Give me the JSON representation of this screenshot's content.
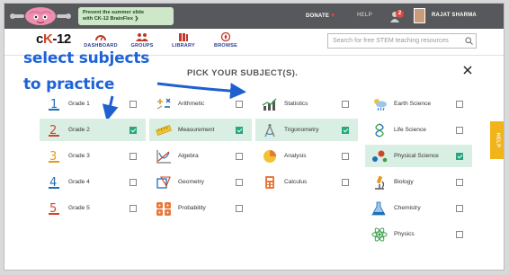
{
  "promo": {
    "line1": "Prevent the summer slide",
    "line2": "with CK-12 BrainFlex ❯"
  },
  "topbar": {
    "donate": "DONATE",
    "help": "HELP",
    "notif_count": "2",
    "user": "RAJAT SHARMA"
  },
  "logo": {
    "prefix": "c",
    "k": "K",
    "suffix": "-12"
  },
  "nav": [
    {
      "label": "DASHBOARD",
      "icon": "dashboard-icon"
    },
    {
      "label": "GROUPS",
      "icon": "groups-icon"
    },
    {
      "label": "LIBRARY",
      "icon": "library-icon"
    },
    {
      "label": "BROWSE",
      "icon": "browse-icon"
    }
  ],
  "search": {
    "placeholder": "Search for free STEM teaching resources"
  },
  "annotation": {
    "line1": "select subjects",
    "line2": "to practice"
  },
  "title": "PICK YOUR SUBJECT(S).",
  "help_tab": "HELP",
  "columns": [
    [
      {
        "label": "Grade 1",
        "icon": "grade-1-icon",
        "checked": false
      },
      {
        "label": "Grade 2",
        "icon": "grade-2-icon",
        "checked": true
      },
      {
        "label": "Grade 3",
        "icon": "grade-3-icon",
        "checked": false
      },
      {
        "label": "Grade 4",
        "icon": "grade-4-icon",
        "checked": false
      },
      {
        "label": "Grade 5",
        "icon": "grade-5-icon",
        "checked": false
      }
    ],
    [
      {
        "label": "Arithmetic",
        "icon": "arithmetic-icon",
        "checked": false
      },
      {
        "label": "Measurement",
        "icon": "ruler-icon",
        "checked": true
      },
      {
        "label": "Algebra",
        "icon": "algebra-graph-icon",
        "checked": false
      },
      {
        "label": "Geometry",
        "icon": "geometry-icon",
        "checked": false
      },
      {
        "label": "Probability",
        "icon": "dice-icon",
        "checked": false
      }
    ],
    [
      {
        "label": "Statistics",
        "icon": "statistics-chart-icon",
        "checked": false
      },
      {
        "label": "Trigonometry",
        "icon": "compass-icon",
        "checked": true
      },
      {
        "label": "Analysis",
        "icon": "pie-chart-icon",
        "checked": false
      },
      {
        "label": "Calculus",
        "icon": "calculator-icon",
        "checked": false
      }
    ],
    [
      {
        "label": "Earth Science",
        "icon": "weather-icon",
        "checked": false
      },
      {
        "label": "Life Science",
        "icon": "dna-icon",
        "checked": false
      },
      {
        "label": "Physical Science",
        "icon": "molecules-icon",
        "checked": true
      },
      {
        "label": "Biology",
        "icon": "microscope-icon",
        "checked": false
      },
      {
        "label": "Chemistry",
        "icon": "flask-icon",
        "checked": false
      },
      {
        "label": "Physics",
        "icon": "atom-icon",
        "checked": false
      }
    ]
  ],
  "colors": {
    "topbar": "#57585b",
    "selected_row": "#d9efe3",
    "checked": "#27a67f",
    "annotation": "#1e63d6",
    "help_tab": "#f2b41b"
  }
}
